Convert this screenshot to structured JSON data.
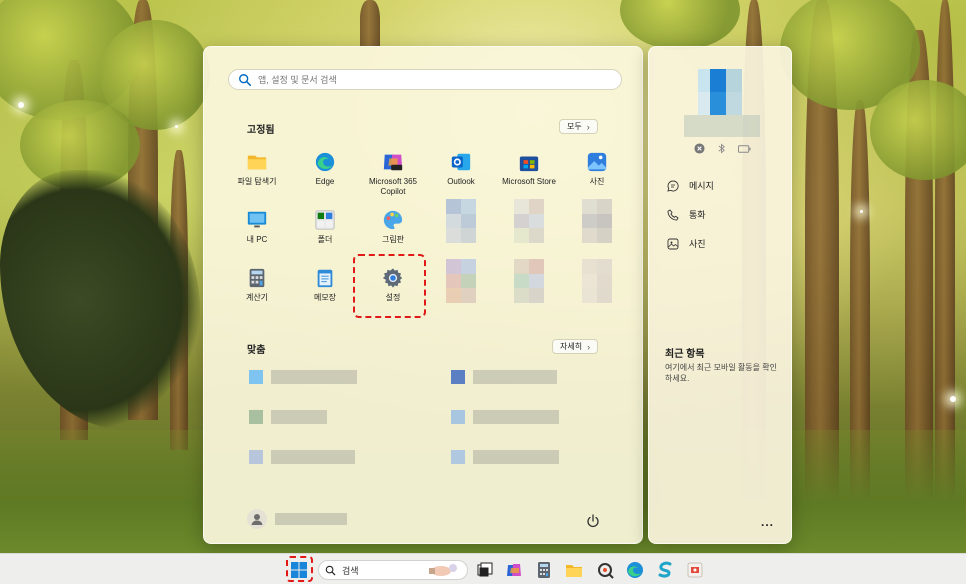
{
  "start_menu": {
    "search_placeholder": "앱, 설정 및 문서 검색",
    "pinned": {
      "title": "고정됨",
      "all_button": "모두",
      "apps": [
        {
          "label": "파일 탐색기",
          "icon": "folder-icon"
        },
        {
          "label": "Edge",
          "icon": "edge-icon"
        },
        {
          "label": "Microsoft 365\nCopilot",
          "icon": "m365-copilot-icon"
        },
        {
          "label": "Outlook",
          "icon": "outlook-icon"
        },
        {
          "label": "Microsoft Store",
          "icon": "store-icon"
        },
        {
          "label": "사진",
          "icon": "photos-icon"
        },
        {
          "label": "내 PC",
          "icon": "monitor-icon"
        },
        {
          "label": "폴더",
          "icon": "xbox-folder-icon"
        },
        {
          "label": "그림판",
          "icon": "paint-icon"
        },
        {
          "label": "계산기",
          "icon": "calculator-icon"
        },
        {
          "label": "메모장",
          "icon": "notepad-icon"
        },
        {
          "label": "설정",
          "icon": "gear-icon"
        }
      ]
    },
    "recommended": {
      "title": "맞춤",
      "more_button": "자세히"
    }
  },
  "side_panel": {
    "actions": [
      {
        "label": "메시지",
        "icon": "message-icon"
      },
      {
        "label": "통화",
        "icon": "phone-icon"
      },
      {
        "label": "사진",
        "icon": "photo-icon"
      }
    ],
    "recent_title": "최근 항목",
    "recent_desc": "여기에서 최근 모바일 활동을 확인하세요.",
    "more": "..."
  },
  "taskbar": {
    "search_label": "검색"
  },
  "colors": {
    "highlight": "#e01818",
    "accent": "#0067c0"
  }
}
